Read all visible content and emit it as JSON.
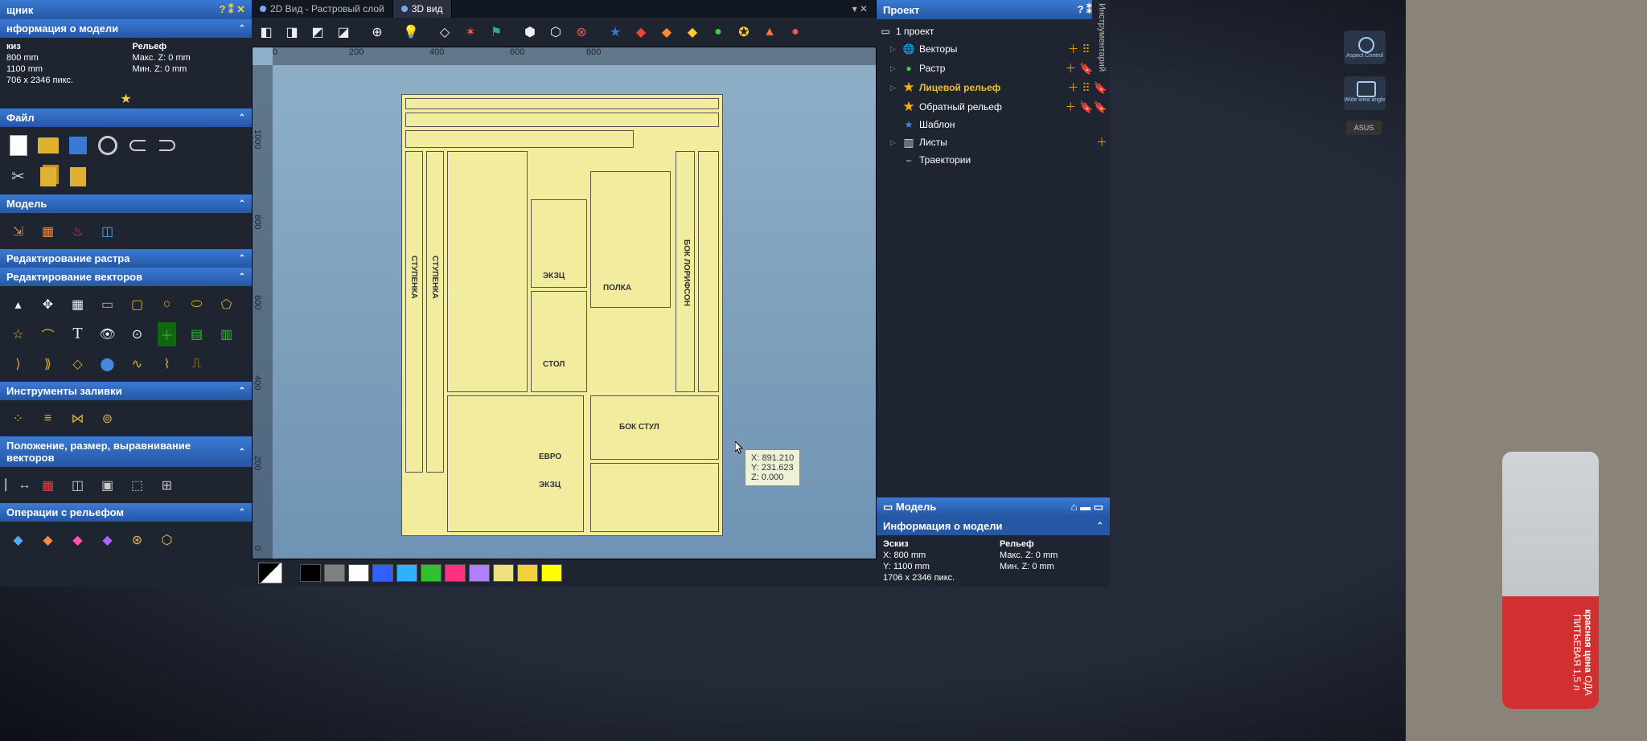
{
  "window": {
    "title_fragment": "щник"
  },
  "tabs": {
    "items": [
      {
        "label": "2D Вид - Растровый слой",
        "active": false
      },
      {
        "label": "3D вид",
        "active": true
      }
    ]
  },
  "left_panel": {
    "model_info_header": "нформация о модели",
    "sketch_label": "киз",
    "sketch_w": "800 mm",
    "sketch_h": "1100 mm",
    "sketch_px": "706 x 2346 пикс.",
    "relief_label": "Рельеф",
    "relief_max": "Макс. Z: 0 mm",
    "relief_min": "Мин. Z: 0 mm",
    "file_header": "Файл",
    "model_header": "Модель",
    "raster_edit_header": "Редактирование растра",
    "vector_edit_header": "Редактирование векторов",
    "fill_tools_header": "Инструменты заливки",
    "pos_align_header": "Положение, размер, выравнивание векторов",
    "relief_ops_header": "Операции с рельефом"
  },
  "main_toolbar": {
    "icons": [
      "cube-iso",
      "cube-front",
      "cube-right",
      "cube-top",
      "zoom-in",
      "lightbulb",
      "layers",
      "xyz-axes",
      "plugin",
      "hex-grid",
      "hex-outline",
      "rgb-circles",
      "star-blue",
      "layer-red",
      "layer-orange",
      "layer-yellow",
      "circle-green",
      "star-badge",
      "pyramid",
      "sphere-colors"
    ]
  },
  "ruler": {
    "h": [
      "0",
      "200",
      "400",
      "600",
      "800"
    ],
    "v": [
      "0",
      "200",
      "400",
      "600",
      "800",
      "1000"
    ]
  },
  "parts": {
    "labels": {
      "stupenka1": "СТУПЕНКА",
      "stupenka2": "СТУПЕНКА",
      "ekzc1": "ЭКЗЦ",
      "polka": "ПОЛКА",
      "stol": "СТОЛ",
      "bok_lorifson": "БОК ЛОРИФСОН",
      "bok_stul": "БОК СТУЛ",
      "evro": "ЕВРО",
      "ekzc2": "ЭКЗЦ"
    }
  },
  "tooltip": {
    "x": "X: 891.210",
    "y": "Y: 231.623",
    "z": "Z: 0.000"
  },
  "right_panel": {
    "project_header": "Проект",
    "project_name": "1 проект",
    "nodes": [
      {
        "label": "Векторы",
        "icon": "globe",
        "expandable": true
      },
      {
        "label": "Растр",
        "icon": "circle-green",
        "expandable": true
      },
      {
        "label": "Лицевой рельеф",
        "icon": "star-gold",
        "expandable": true,
        "highlight": true
      },
      {
        "label": "Обратный рельеф",
        "icon": "star-gold",
        "expandable": false
      },
      {
        "label": "Шаблон",
        "icon": "star-blue",
        "expandable": false
      },
      {
        "label": "Листы",
        "icon": "sheets",
        "expandable": true
      },
      {
        "label": "Траектории",
        "icon": "toolpath",
        "expandable": false
      }
    ],
    "model_header": "Модель",
    "model_info_header": "Информация о модели",
    "sketch_label": "Эскиз",
    "x": "X: 800 mm",
    "y": "Y: 1100 mm",
    "px": "1706 x 2346 пикс.",
    "relief_label": "Рельеф",
    "max": "Макс. Z: 0 mm",
    "min": "Мин. Z: 0 mm",
    "vtab": "Инструментарий"
  },
  "palette": {
    "primary": "#000000",
    "colors": [
      "#000000",
      "#808080",
      "#ffffff",
      "#3060ff",
      "#30b0ff",
      "#30c030",
      "#ff3080",
      "#b080ff",
      "#ede080",
      "#f0d040",
      "#ffff00"
    ]
  },
  "ext_icons": {
    "aspect": "Aspect Control",
    "wide": "Wide view angle",
    "asus": "ASUS"
  },
  "bottle": {
    "brand": "красная цена",
    "text": "ОДА ПИТЬЕВАЯ",
    "vol": "1,5 л"
  }
}
